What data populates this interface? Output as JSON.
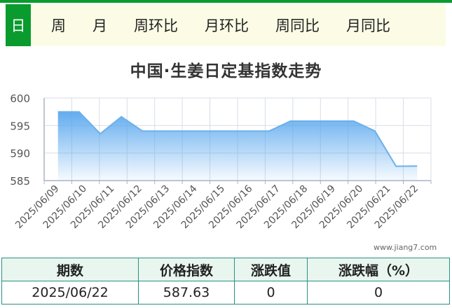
{
  "tabs": [
    {
      "label": "日",
      "active": true
    },
    {
      "label": "周",
      "active": false
    },
    {
      "label": "月",
      "active": false
    },
    {
      "label": "周环比",
      "active": false
    },
    {
      "label": "月环比",
      "active": false
    },
    {
      "label": "周同比",
      "active": false
    },
    {
      "label": "月同比",
      "active": false
    }
  ],
  "colors": {
    "accent": "#0a9b2e",
    "line": "#6eb0ea",
    "fill_top": "#5aa8ee",
    "table_border": "#2a8f7f"
  },
  "chart_data": {
    "type": "area",
    "title": "中国·生姜日定基指数走势",
    "x": [
      "2025/06/09",
      "2025/06/10",
      "2025/06/11",
      "2025/06/12",
      "2025/06/13",
      "2025/06/14",
      "2025/06/15",
      "2025/06/16",
      "2025/06/17",
      "2025/06/18",
      "2025/06/19",
      "2025/06/20",
      "2025/06/21",
      "2025/06/22"
    ],
    "series_raw": [
      [
        0,
        597.5
      ],
      [
        0.5,
        597.5
      ],
      [
        1,
        593.5
      ],
      [
        1.5,
        596.6
      ],
      [
        2,
        594
      ],
      [
        3,
        594
      ],
      [
        4,
        594
      ],
      [
        5,
        594
      ],
      [
        5.5,
        595.8
      ],
      [
        6,
        595.8
      ],
      [
        7,
        595.8
      ],
      [
        7.5,
        594
      ],
      [
        8,
        587.6
      ],
      [
        8.5,
        587.63
      ]
    ],
    "yticks": [
      585,
      590,
      595,
      600
    ],
    "ylim": [
      585,
      600
    ],
    "grid": true,
    "watermark": "www.jiang7.com"
  },
  "table": {
    "headers": [
      "期数",
      "价格指数",
      "涨跌值",
      "涨跌幅（%）"
    ],
    "row": [
      "2025/06/22",
      "587.63",
      "0",
      "0"
    ]
  }
}
